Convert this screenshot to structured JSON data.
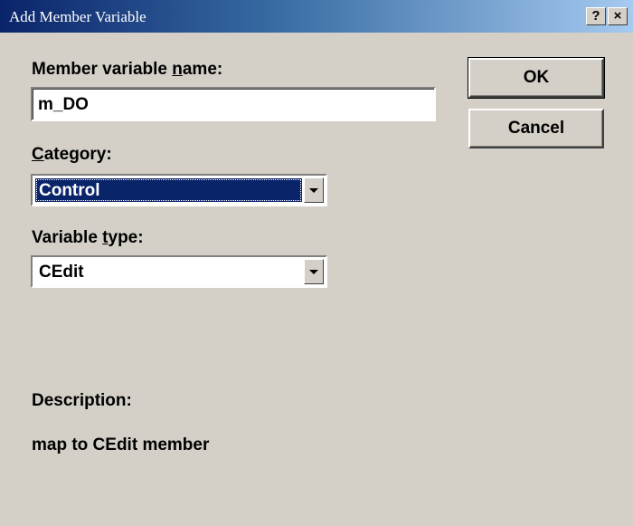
{
  "window": {
    "title": "Add Member Variable",
    "help_button": "?",
    "close_button": "×"
  },
  "form": {
    "member_name_label_pre": "Member variable ",
    "member_name_label_ul": "n",
    "member_name_label_post": "ame:",
    "member_name_value": "m_DO",
    "category_label_ul": "C",
    "category_label_post": "ategory:",
    "category_value": "Control",
    "variable_type_label_pre": "Variable ",
    "variable_type_label_ul": "t",
    "variable_type_label_post": "ype:",
    "variable_type_value": "CEdit",
    "description_label": "Description:",
    "description_text": "map to CEdit member"
  },
  "buttons": {
    "ok": "OK",
    "cancel": "Cancel"
  }
}
